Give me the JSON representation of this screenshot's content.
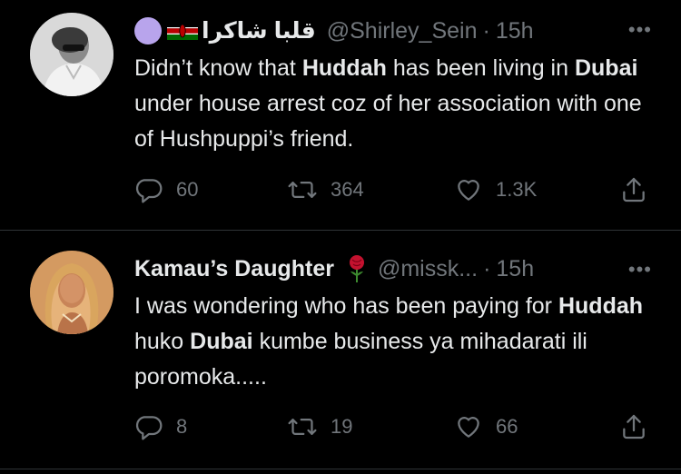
{
  "tweets": [
    {
      "display_name": "قلبا شاكرا",
      "handle": "@Shirley_Sein",
      "sep": "·",
      "time": "15h",
      "more": "•••",
      "body": [
        {
          "t": "Didn’t know that ",
          "b": false
        },
        {
          "t": "Huddah",
          "b": true
        },
        {
          "t": " has been living in ",
          "b": false
        },
        {
          "t": "Dubai",
          "b": true
        },
        {
          "t": " under house arrest coz of her association with one of Hushpuppi’s friend.",
          "b": false
        }
      ],
      "replies": "60",
      "retweets": "364",
      "likes": "1.3K"
    },
    {
      "display_name": "Kamau’s Daughter",
      "handle": "@missk...",
      "sep": "·",
      "time": "15h",
      "more": "•••",
      "body": [
        {
          "t": "I was wondering who has been paying for ",
          "b": false
        },
        {
          "t": "Huddah",
          "b": true
        },
        {
          "t": " huko ",
          "b": false
        },
        {
          "t": "Dubai",
          "b": true
        },
        {
          "t": " kumbe business ya mihadarati ili poromoka.....",
          "b": false
        }
      ],
      "replies": "8",
      "retweets": "19",
      "likes": "66"
    }
  ],
  "colors": {
    "background": "#000000",
    "text": "#e7e9ea",
    "muted": "#71767b",
    "divider": "#2f3336",
    "accent_dot": "#b8a4ec"
  },
  "icons": [
    "reply-icon",
    "retweet-icon",
    "like-icon",
    "share-icon",
    "rose-icon",
    "kenya-flag-icon",
    "more-icon"
  ]
}
